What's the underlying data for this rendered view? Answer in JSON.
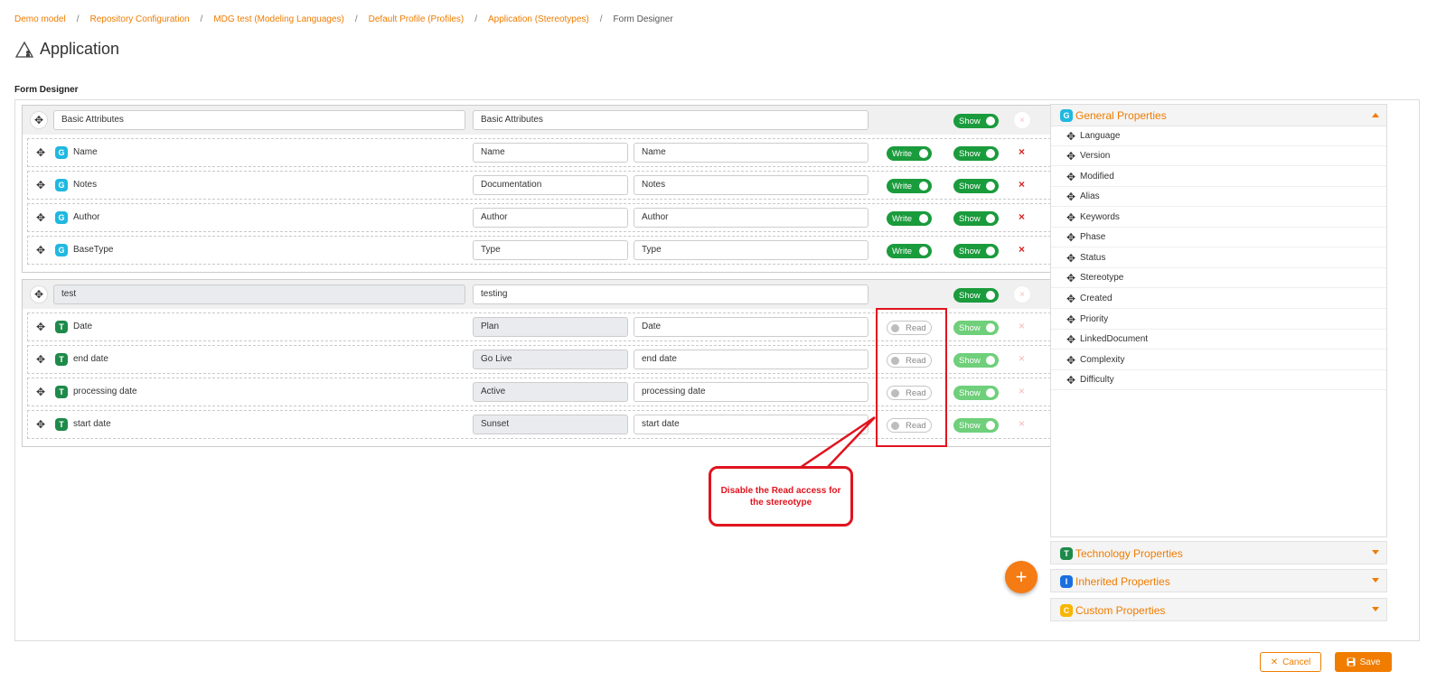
{
  "breadcrumb": {
    "items": [
      "Demo model",
      "Repository Configuration",
      "MDG test (Modeling Languages)",
      "Default Profile (Profiles)",
      "Application (Stereotypes)"
    ],
    "current": "Form Designer",
    "separator": "/"
  },
  "page": {
    "title": "Application",
    "section_label": "Form Designer"
  },
  "groups": [
    {
      "name": "Basic Attributes",
      "caption": "Basic Attributes",
      "visibility": "Show",
      "rows": [
        {
          "badge": "G",
          "name": "Name",
          "label": "Name",
          "caption": "Name",
          "access": "Write",
          "visibility": "Show"
        },
        {
          "badge": "G",
          "name": "Notes",
          "label": "Documentation",
          "caption": "Notes",
          "access": "Write",
          "visibility": "Show"
        },
        {
          "badge": "G",
          "name": "Author",
          "label": "Author",
          "caption": "Author",
          "access": "Write",
          "visibility": "Show"
        },
        {
          "badge": "G",
          "name": "BaseType",
          "label": "Type",
          "caption": "Type",
          "access": "Write",
          "visibility": "Show"
        }
      ]
    },
    {
      "name": "test",
      "caption": "testing",
      "visibility": "Show",
      "rows": [
        {
          "badge": "T",
          "name": "Date",
          "label": "Plan",
          "caption": "Date",
          "access": "Read",
          "visibility": "Show"
        },
        {
          "badge": "T",
          "name": "end date",
          "label": "Go Live",
          "caption": "end date",
          "access": "Read",
          "visibility": "Show"
        },
        {
          "badge": "T",
          "name": "processing date",
          "label": "Active",
          "caption": "processing date",
          "access": "Read",
          "visibility": "Show"
        },
        {
          "badge": "T",
          "name": "start date",
          "label": "Sunset",
          "caption": "start date",
          "access": "Read",
          "visibility": "Show"
        }
      ]
    }
  ],
  "delete_glyph": "×",
  "callout": {
    "text": "Disable the Read access for the stereotype"
  },
  "fab": {
    "label": "+"
  },
  "side_panel": {
    "general": {
      "badge": "G",
      "title": "General Properties",
      "items": [
        "Language",
        "Version",
        "Modified",
        "Alias",
        "Keywords",
        "Phase",
        "Status",
        "Stereotype",
        "Created",
        "Priority",
        "LinkedDocument",
        "Complexity",
        "Difficulty"
      ]
    },
    "technology": {
      "badge": "T",
      "title": "Technology Properties"
    },
    "inherited": {
      "badge": "I",
      "title": "Inherited Properties"
    },
    "custom": {
      "badge": "C",
      "title": "Custom Properties"
    }
  },
  "footer": {
    "cancel_label": "Cancel",
    "save_label": "Save"
  },
  "colors": {
    "accent": "#f07c00",
    "toggle_on": "#1a9b3c",
    "annotation": "#e0141e"
  }
}
